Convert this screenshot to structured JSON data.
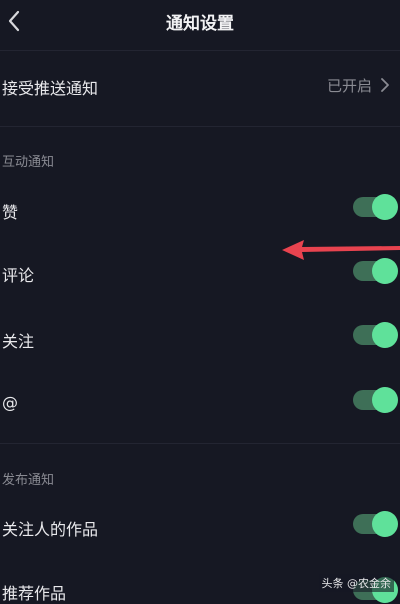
{
  "header": {
    "title": "通知设置"
  },
  "push": {
    "label": "接受推送通知",
    "status": "已开启"
  },
  "interaction": {
    "section_label": "互动通知",
    "items": [
      {
        "label": "赞",
        "enabled": true
      },
      {
        "label": "评论",
        "enabled": true
      },
      {
        "label": "关注",
        "enabled": true
      },
      {
        "label": "@",
        "enabled": true
      }
    ]
  },
  "publish": {
    "section_label": "发布通知",
    "items": [
      {
        "label": "关注人的作品",
        "enabled": true
      },
      {
        "label": "推荐作品",
        "enabled": true
      }
    ]
  },
  "watermark": "头条 @农金余",
  "colors": {
    "background": "#161823",
    "toggle_track": "#3e6f57",
    "toggle_knob": "#5fe19a",
    "annotation_arrow": "#e8434f"
  },
  "icons": {
    "back": "chevron-left-icon",
    "push_chevron": "chevron-right-icon"
  }
}
